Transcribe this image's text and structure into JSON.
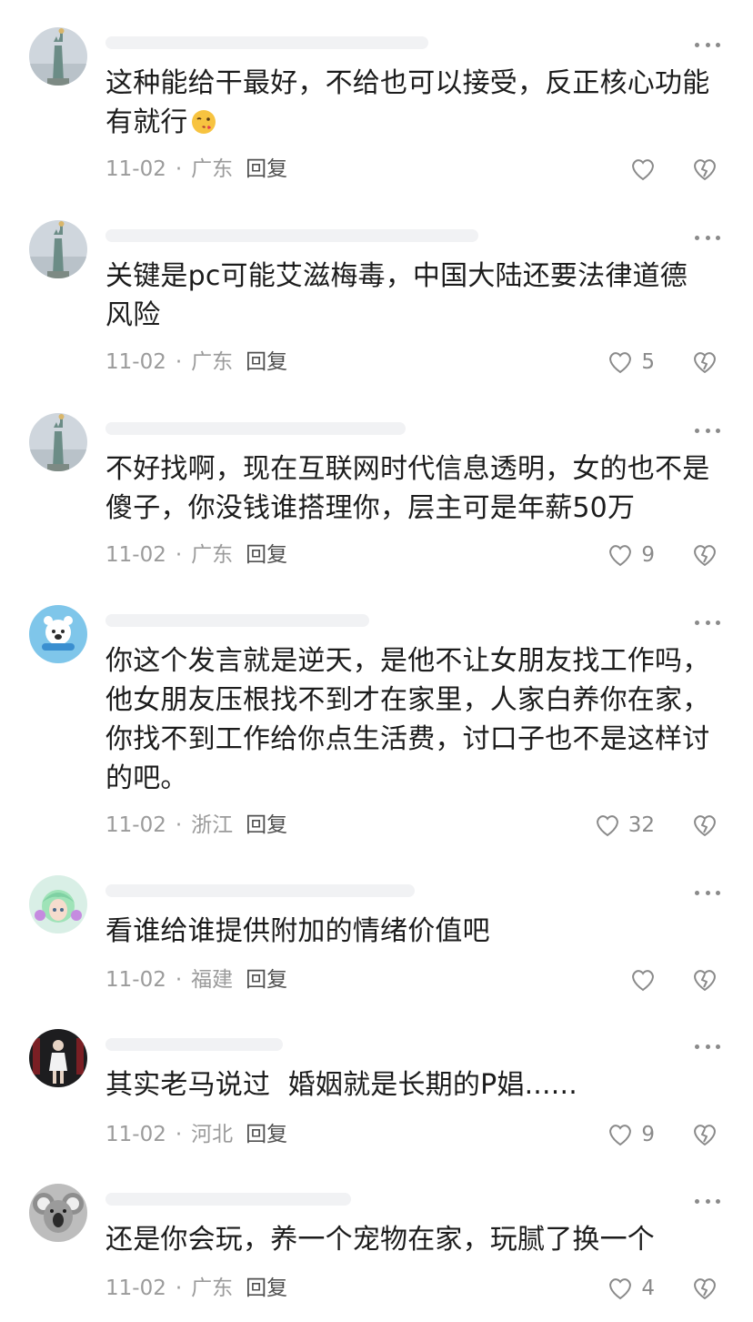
{
  "comments": [
    {
      "text_lines": [
        "这种能给干最好，不给也可以接受，反正核心功能",
        "有就行"
      ],
      "emoji": "wink-kiss-emoji",
      "date": "11-02",
      "location": "广东",
      "reply": "回复",
      "likes": "",
      "avatar": "statue-of-liberty"
    },
    {
      "text_lines": [
        "关键是pc可能艾滋梅毒，中国大陆还要法律道德",
        "风险"
      ],
      "date": "11-02",
      "location": "广东",
      "reply": "回复",
      "likes": "5",
      "avatar": "statue-of-liberty"
    },
    {
      "text_lines": [
        "不好找啊，现在互联网时代信息透明，女的也不是",
        "傻子，你没钱谁搭理你，层主可是年薪50万"
      ],
      "date": "11-02",
      "location": "广东",
      "reply": "回复",
      "likes": "9",
      "avatar": "statue-of-liberty"
    },
    {
      "text_lines": [
        "你这个发言就是逆天，是他不让女朋友找工作吗，",
        "他女朋友压根找不到才在家里，人家白养你在家，",
        "你找不到工作给你点生活费，讨口子也不是这样讨",
        "的吧。"
      ],
      "date": "11-02",
      "location": "浙江",
      "reply": "回复",
      "likes": "32",
      "avatar": "blue-bear"
    },
    {
      "text_lines": [
        "看谁给谁提供附加的情绪价值吧"
      ],
      "date": "11-02",
      "location": "福建",
      "reply": "回复",
      "likes": "",
      "avatar": "anime-girl"
    },
    {
      "text_lines": [
        "其实老马说过  婚姻就是长期的P娼......"
      ],
      "date": "11-02",
      "location": "河北",
      "reply": "回复",
      "likes": "9",
      "avatar": "dark-figure"
    },
    {
      "text_lines": [
        "还是你会玩，养一个宠物在家，玩腻了换一个"
      ],
      "date": "11-02",
      "location": "广东",
      "reply": "回复",
      "likes": "4",
      "avatar": "koala"
    }
  ],
  "icons": {
    "more": "more-dots-icon",
    "like": "heart-outline-icon",
    "dislike": "broken-heart-icon"
  },
  "colors": {
    "text": "#1c1c1c",
    "meta": "#9b9b9b",
    "icon": "#8a8a8a"
  }
}
